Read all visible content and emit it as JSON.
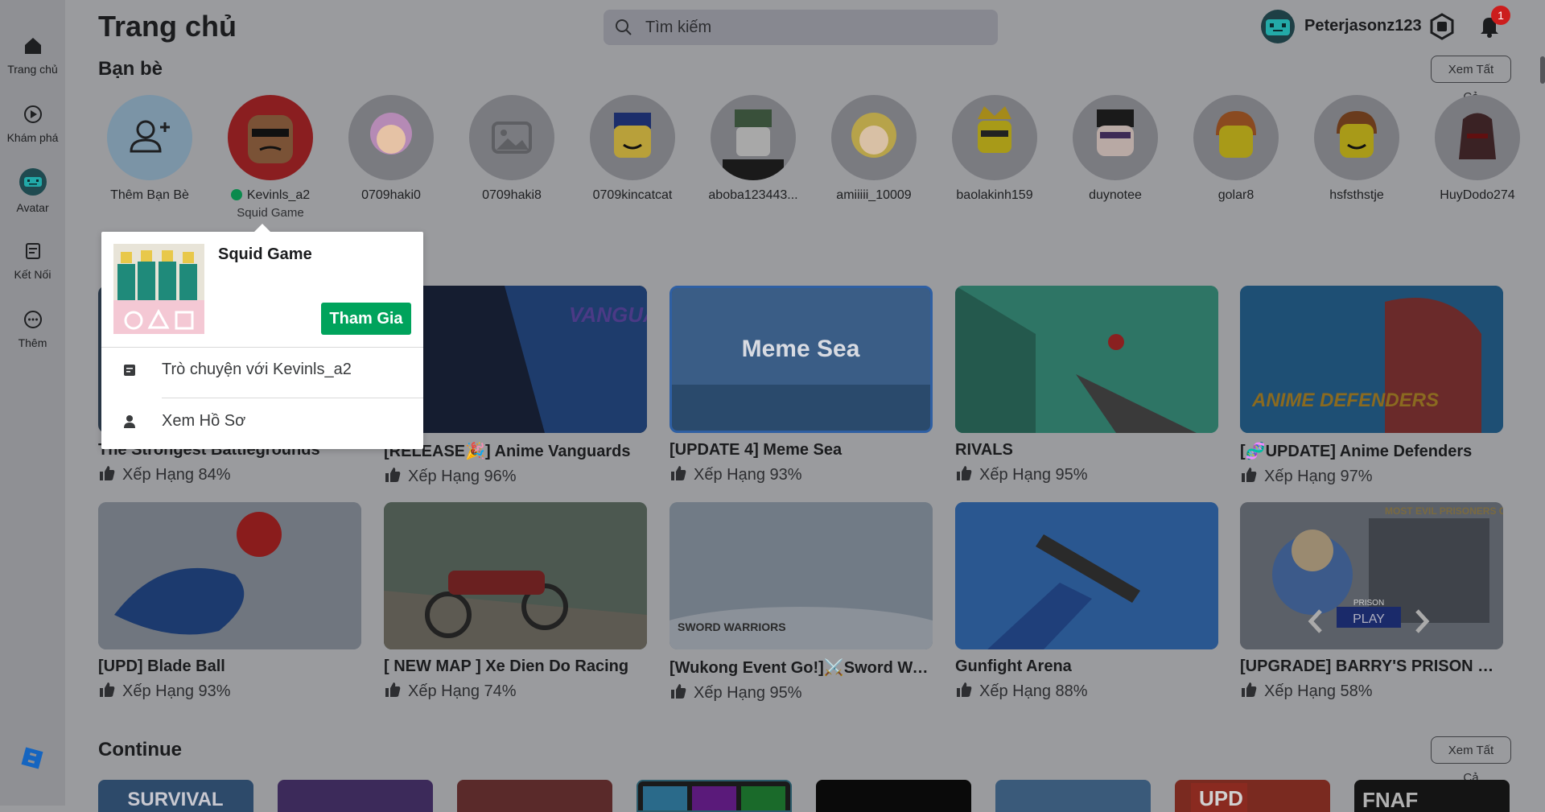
{
  "sidebar": {
    "items": [
      {
        "label": "Trang chủ",
        "icon": "home-icon"
      },
      {
        "label": "Khám phá",
        "icon": "play-circle-icon"
      },
      {
        "label": "Avatar",
        "icon": "avatar-icon"
      },
      {
        "label": "Kết Nối",
        "icon": "chat-icon"
      },
      {
        "label": "Thêm",
        "icon": "more-icon"
      }
    ],
    "logo": "roblox-logo"
  },
  "header": {
    "title": "Trang chủ",
    "search_placeholder": "Tìm kiếm",
    "username": "Peterjasonz123",
    "notification_count": "1"
  },
  "friends": {
    "title": "Bạn bè",
    "see_all": "Xem Tất Cả",
    "add_label": "Thêm Bạn Bè",
    "list": [
      {
        "name": "Kevinls_a2",
        "status": "Squid Game",
        "online": true
      },
      {
        "name": "0709haki0"
      },
      {
        "name": "0709haki8"
      },
      {
        "name": "0709kincatcat"
      },
      {
        "name": "aboba123443..."
      },
      {
        "name": "amiiiii_10009"
      },
      {
        "name": "baolakinh159"
      },
      {
        "name": "duynotee"
      },
      {
        "name": "golar8"
      },
      {
        "name": "hsfsthstje"
      },
      {
        "name": "HuyDodo274"
      }
    ]
  },
  "games": {
    "rows": [
      [
        {
          "title": "The Strongest Battlegrounds",
          "rating": "Xếp Hạng 84%"
        },
        {
          "title": "[RELEASE🎉] Anime Vanguards",
          "rating": "Xếp Hạng 96%"
        },
        {
          "title": "[UPDATE 4] Meme Sea",
          "rating": "Xếp Hạng 93%"
        },
        {
          "title": "RIVALS",
          "rating": "Xếp Hạng 95%"
        },
        {
          "title": "[🧬UPDATE] Anime Defenders",
          "rating": "Xếp Hạng 97%"
        }
      ],
      [
        {
          "title": "[UPD] Blade Ball",
          "rating": "Xếp Hạng 93%"
        },
        {
          "title": "[ NEW MAP ] Xe Dien Do Racing",
          "rating": "Xếp Hạng 74%"
        },
        {
          "title": "[Wukong Event Go!]⚔️Sword Wa...",
          "rating": "Xếp Hạng 95%"
        },
        {
          "title": "Gunfight Arena",
          "rating": "Xếp Hạng 88%"
        },
        {
          "title": "[UPGRADE] BARRY'S PRISON RU...",
          "rating": "Xếp Hạng 58%"
        }
      ]
    ],
    "thumb_texts": {
      "vanguards": "VANGUARDS",
      "meme_sea": "Meme Sea",
      "anime_defenders": "ANIME DEFENDERS",
      "sword_warriors": "SWORD WARRIORS",
      "barry_play": "PLAY",
      "barry_prison": "PRISON",
      "barry_banner": "MOST EVIL PRISONERS CELL"
    }
  },
  "continue": {
    "title": "Continue",
    "see_all": "Xem Tất Cả",
    "thumb_texts": [
      "SURVIVAL",
      "UPD",
      "FNAF"
    ]
  },
  "popup": {
    "game_name": "Squid Game",
    "join_label": "Tham Gia",
    "chat_label": "Trò chuyện với Kevinls_a2",
    "profile_label": "Xem Hồ Sơ"
  },
  "colors": {
    "overlay_bg": "#9a9b9e",
    "join_green": "#00a35c",
    "badge_red": "#cc1d1d",
    "online_green": "#0b8a4d"
  }
}
